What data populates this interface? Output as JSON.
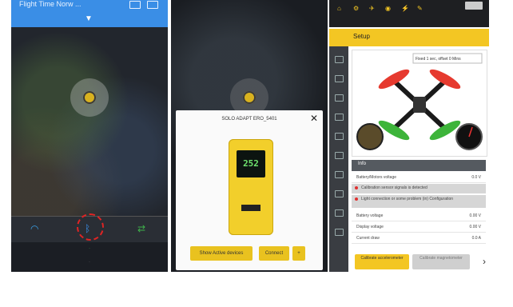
{
  "phone1": {
    "title": "Flight Time Norw ..."
  },
  "phone2": {
    "dialog_title": "SOLO ADAPT ERO_5401",
    "device_reading": "252",
    "buttons": {
      "show_active": "Show Active devices",
      "connect": "Connect"
    }
  },
  "phone3": {
    "screen_title": "Setup",
    "badge_text": "Fixed 1 sec, offset 0 Mins",
    "info_header": "Info",
    "rows": [
      {
        "key": "Battery/Motors voltage",
        "value": "0.0 V"
      },
      {
        "key": "Battery voltage",
        "value": "0.00 V"
      },
      {
        "key": "Display voltage",
        "value": "0.00 V"
      },
      {
        "key": "Current draw",
        "value": "0.0 A"
      }
    ],
    "warnings": [
      "Calibration sensor signals is detected",
      "Light connection or some problem (in) Configuration"
    ],
    "bottom_buttons": [
      {
        "label": "Calibrate accelerometer"
      },
      {
        "label": "Calibrate magnetometer"
      }
    ]
  },
  "colors": {
    "accent_yellow": "#f3c623",
    "blue": "#3a8ee6",
    "dark": "#1e1f22"
  }
}
